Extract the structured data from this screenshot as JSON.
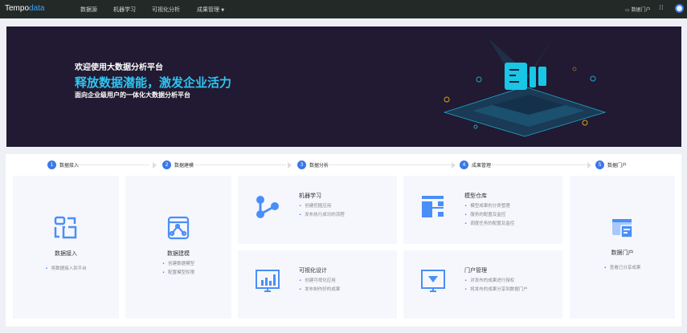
{
  "header": {
    "logo_a": "Tempo",
    "logo_b": "data",
    "nav": [
      "数据源",
      "机器学习",
      "可视化分析",
      "成果管理"
    ],
    "portal": "数据门户"
  },
  "banner": {
    "welcome": "欢迎使用大数据分析平台",
    "slogan": "释放数据潜能，激发企业活力",
    "sub": "面向企业级用户的一体化大数据分析平台"
  },
  "steps": [
    {
      "n": "1",
      "label": "数据接入"
    },
    {
      "n": "2",
      "label": "数据建模"
    },
    {
      "n": "3",
      "label": "数据分析"
    },
    {
      "n": "4",
      "label": "成果管理"
    },
    {
      "n": "5",
      "label": "数据门户"
    }
  ],
  "cards": {
    "ingest": {
      "title": "数据接入",
      "items": [
        "将数据接入到平台"
      ]
    },
    "model": {
      "title": "数据建模",
      "items": [
        "创建数据模型",
        "配置模型权限"
      ]
    },
    "ml": {
      "title": "机器学习",
      "items": [
        "创建挖掘应用",
        "发布执行成功的流程"
      ]
    },
    "vis": {
      "title": "可视化设计",
      "items": [
        "创建可视化应用",
        "发布制作好的成果"
      ]
    },
    "repo": {
      "title": "模型仓库",
      "items": [
        "模型成果的分类管理",
        "服务的配置及监控",
        "调度任务的配置及监控"
      ]
    },
    "pm": {
      "title": "门户管理",
      "items": [
        "对发布的成果进行授权",
        "将发布的成果分享到数据门户"
      ]
    },
    "portal": {
      "title": "数据门户",
      "items": [
        "查看已分享成果"
      ]
    }
  },
  "colors": {
    "accent": "#3b78e7",
    "icon": "#4a8ff7",
    "banner": "#211a32"
  }
}
